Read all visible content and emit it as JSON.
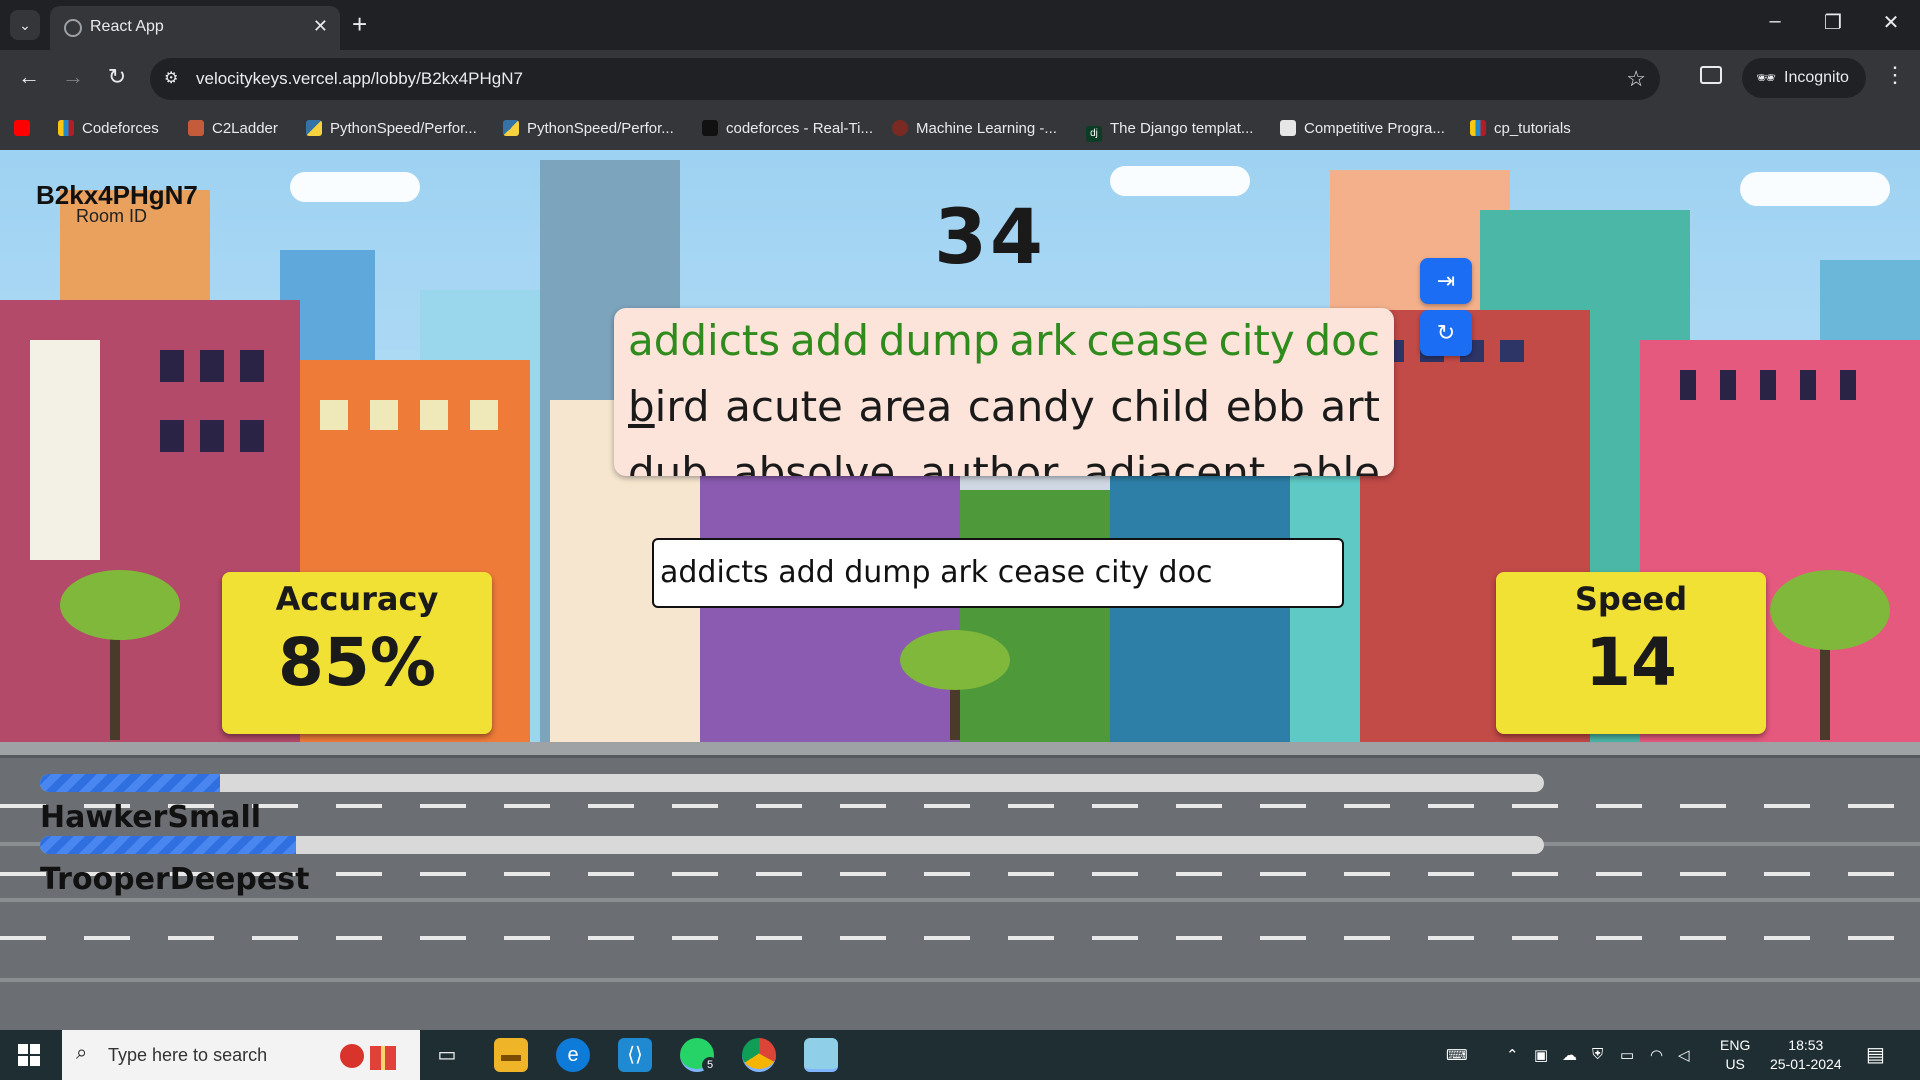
{
  "browser": {
    "tab_title": "React App",
    "url": "velocitykeys.vercel.app/lobby/B2kx4PHgN7",
    "incognito_label": "Incognito",
    "bookmarks": [
      {
        "label": "Codeforces"
      },
      {
        "label": "C2Ladder"
      },
      {
        "label": "PythonSpeed/Perfor..."
      },
      {
        "label": "PythonSpeed/Perfor..."
      },
      {
        "label": "codeforces - Real-Ti..."
      },
      {
        "label": "Machine Learning -..."
      },
      {
        "label": "The Django templat..."
      },
      {
        "label": "Competitive Progra..."
      },
      {
        "label": "cp_tutorials"
      }
    ]
  },
  "game": {
    "room_id": "B2kx4PHgN7",
    "room_label": "Room ID",
    "timer": "34",
    "words": {
      "typed_line": [
        "addicts",
        "add",
        "dump",
        "ark",
        "cease",
        "city",
        "doc"
      ],
      "current_word_first": "b",
      "current_word_rest": "ird",
      "line2_rest": [
        "acute",
        "area",
        "candy",
        "child",
        "ebb",
        "art"
      ],
      "line3": [
        "dub",
        "absolve",
        "author",
        "adjacent",
        "able"
      ]
    },
    "input_value": "addicts add dump ark cease city doc",
    "accuracy": {
      "title": "Accuracy",
      "value": "85%"
    },
    "speed": {
      "title": "Speed",
      "value": "14"
    },
    "players": [
      {
        "name": "HawkerSmall",
        "progress_fraction": 0.12
      },
      {
        "name": "TrooperDeepest",
        "progress_fraction": 0.17
      }
    ]
  },
  "taskbar": {
    "search_placeholder": "Type here to search",
    "whatsapp_badge": "5",
    "lang_top": "ENG",
    "lang_bottom": "US",
    "time": "18:53",
    "date": "25-01-2024"
  },
  "colors": {
    "typed_word": "#2e8b1c",
    "stat_card": "#f2e135",
    "action_button": "#1b6ef3",
    "progress_fill": "#2f6fe0"
  }
}
